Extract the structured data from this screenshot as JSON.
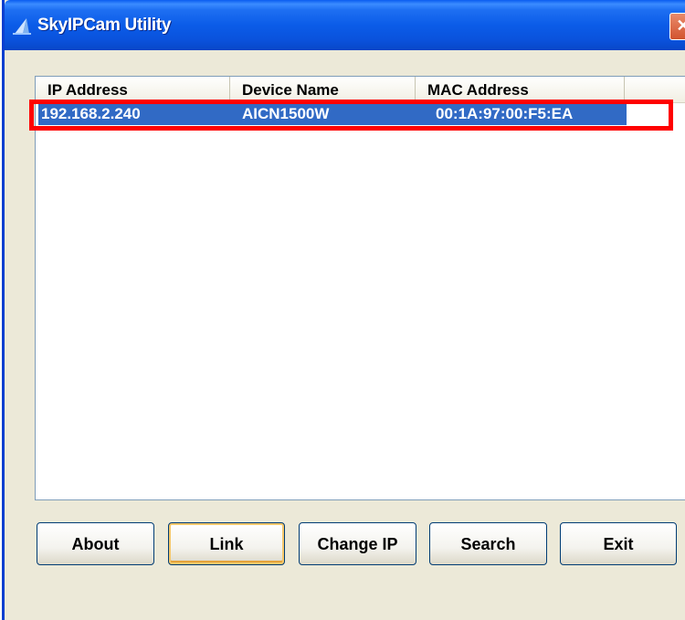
{
  "window": {
    "title": "SkyIPCam Utility",
    "close_glyph": "✕",
    "accent_color": "#0a52dc"
  },
  "device_list": {
    "columns": [
      "IP Address",
      "Device Name",
      "MAC Address",
      ""
    ],
    "rows": [
      {
        "ip_address": "192.168.2.240",
        "device_name": "AICN1500W",
        "mac_address": "00:1A:97:00:F5:EA",
        "selected": true
      }
    ],
    "selection_color": "#316ac5",
    "highlight_color": "#ff0000"
  },
  "buttons": {
    "about": "About",
    "link": "Link",
    "change_ip": "Change IP",
    "search": "Search",
    "exit": "Exit"
  }
}
